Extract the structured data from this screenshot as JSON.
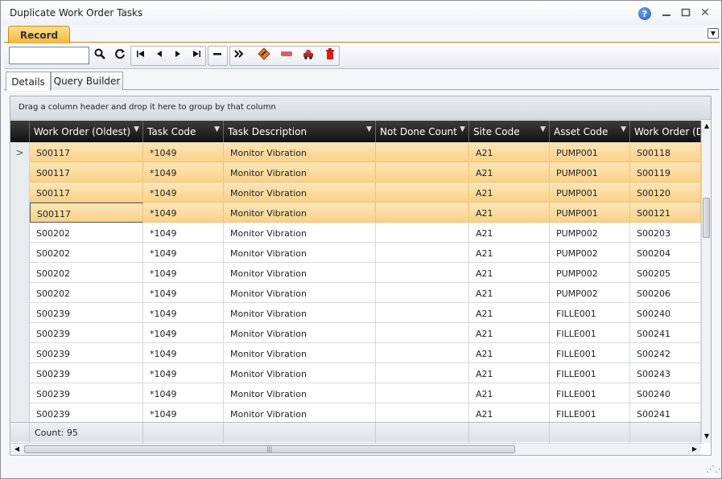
{
  "window": {
    "title": "Duplicate Work Order Tasks"
  },
  "ribbon": {
    "tab_label": "Record"
  },
  "toolbar": {
    "search_value": "",
    "search_placeholder": ""
  },
  "tabs": [
    {
      "label": "Details"
    },
    {
      "label": "Query Builder"
    }
  ],
  "grid": {
    "group_hint": "Drag a column header and drop it here to group by that column",
    "columns": [
      "Work Order (Oldest)",
      "Task Code",
      "Task Description",
      "Not Done Count",
      "Site Code",
      "Asset Code",
      "Work Order (D"
    ],
    "rows": [
      [
        "S00117",
        "*1049",
        "Monitor Vibration",
        "",
        "A21",
        "PUMP001",
        "S00118"
      ],
      [
        "S00117",
        "*1049",
        "Monitor Vibration",
        "",
        "A21",
        "PUMP001",
        "S00119"
      ],
      [
        "S00117",
        "*1049",
        "Monitor Vibration",
        "",
        "A21",
        "PUMP001",
        "S00120"
      ],
      [
        "S00117",
        "*1049",
        "Monitor Vibration",
        "",
        "A21",
        "PUMP001",
        "S00121"
      ],
      [
        "S00202",
        "*1049",
        "Monitor Vibration",
        "",
        "A21",
        "PUMP002",
        "S00203"
      ],
      [
        "S00202",
        "*1049",
        "Monitor Vibration",
        "",
        "A21",
        "PUMP002",
        "S00204"
      ],
      [
        "S00202",
        "*1049",
        "Monitor Vibration",
        "",
        "A21",
        "PUMP002",
        "S00205"
      ],
      [
        "S00202",
        "*1049",
        "Monitor Vibration",
        "",
        "A21",
        "PUMP002",
        "S00206"
      ],
      [
        "S00239",
        "*1049",
        "Monitor Vibration",
        "",
        "A21",
        "FILLE001",
        "S00240"
      ],
      [
        "S00239",
        "*1049",
        "Monitor Vibration",
        "",
        "A21",
        "FILLE001",
        "S00241"
      ],
      [
        "S00239",
        "*1049",
        "Monitor Vibration",
        "",
        "A21",
        "FILLE001",
        "S00242"
      ],
      [
        "S00239",
        "*1049",
        "Monitor Vibration",
        "",
        "A21",
        "FILLE001",
        "S00243"
      ],
      [
        "S00239",
        "*1049",
        "Monitor Vibration",
        "",
        "A21",
        "FILLE001",
        "S00240"
      ],
      [
        "S00239",
        "*1049",
        "Monitor Vibration",
        "",
        "A21",
        "FILLE001",
        "S00241"
      ]
    ],
    "selected_rows": [
      0,
      1,
      2,
      3
    ],
    "current_row_marker": ">",
    "footer_count": "Count: 95"
  },
  "colors": {
    "ribbon_accent": "#f4b43c",
    "selection": "#f9d18a",
    "header_dark": "#1a1a1a"
  },
  "icons": {
    "search": "search-icon",
    "refresh": "refresh-icon",
    "first": "first-record-icon",
    "prev": "previous-record-icon",
    "next": "next-record-icon",
    "last": "last-record-icon",
    "remove": "minus-icon",
    "forward": "double-chevron-icon",
    "duplicate": "duplicate-tool-icon",
    "cancel": "cancel-icon",
    "car": "vehicle-icon",
    "delete": "trash-icon"
  }
}
